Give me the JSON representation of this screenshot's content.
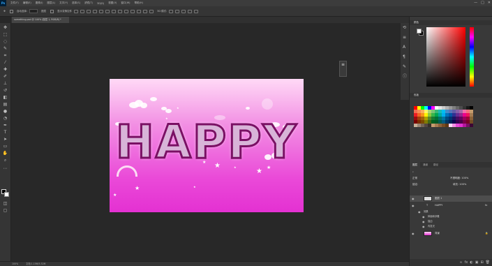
{
  "app": {
    "logo": "Ps"
  },
  "menu": {
    "items": [
      "文件(F)",
      "编辑(E)",
      "图像(I)",
      "图层(L)",
      "文字(Y)",
      "选择(S)",
      "滤镜(T)",
      "3D(D)",
      "视图(V)",
      "窗口(W)",
      "帮助(H)"
    ]
  },
  "window_controls": {
    "minimize": "—",
    "maximize": "□",
    "close": "✕"
  },
  "options_bar": {
    "auto_select_label": "自动选择:",
    "auto_select_value": "图层",
    "transform_label": "显示变换控件"
  },
  "document_tab": {
    "label": "something.psd @ 100% (图层 1, RGB/8) *"
  },
  "canvas": {
    "headline": "HAPPY",
    "colors": {
      "gradient_top": "#ffd9f6",
      "gradient_bottom": "#e431d2",
      "text_stroke": "#7a1064",
      "text_fill": "#d8b4d8"
    }
  },
  "mini_panel": {
    "icon": "≡"
  },
  "status_bar": {
    "zoom": "100%",
    "doc_info": "文档:1.15M/5.32M"
  },
  "color_panel": {
    "title": "颜色"
  },
  "swatches_panel": {
    "title": "色板",
    "colors": [
      "#ff0000",
      "#ffff00",
      "#00ff00",
      "#00ffff",
      "#0000ff",
      "#ff00ff",
      "#ffffff",
      "#e5e5e5",
      "#cccccc",
      "#b3b3b3",
      "#999999",
      "#808080",
      "#666666",
      "#4d4d4d",
      "#333333",
      "#1a1a1a",
      "#000000",
      "#f26c4f",
      "#f68e56",
      "#fbaf5c",
      "#fff467",
      "#acd372",
      "#7cc576",
      "#3bb878",
      "#1abbb4",
      "#00bff3",
      "#438ccb",
      "#5574b9",
      "#605ca8",
      "#855fa8",
      "#a763a8",
      "#f06ea9",
      "#f26d7d",
      "#c69c6d",
      "#ed1c24",
      "#f26522",
      "#f7941d",
      "#fff200",
      "#8dc63f",
      "#39b54a",
      "#00a651",
      "#00a99d",
      "#00aeef",
      "#0072bc",
      "#0054a6",
      "#2e3192",
      "#662d91",
      "#92278f",
      "#ec008c",
      "#ed145b",
      "#a67c52",
      "#9e0b0f",
      "#a0410d",
      "#a3620a",
      "#aba000",
      "#598527",
      "#197b30",
      "#007236",
      "#00746b",
      "#0076a3",
      "#004b80",
      "#003471",
      "#1b1464",
      "#440e62",
      "#630460",
      "#9e005d",
      "#9e0039",
      "#8c6239",
      "#790000",
      "#7b2e00",
      "#7d4900",
      "#827b00",
      "#406618",
      "#005e20",
      "#005826",
      "#005952",
      "#005b7f",
      "#003663",
      "#002157",
      "#0d004c",
      "#32004b",
      "#4b0049",
      "#7b0046",
      "#7a0026",
      "#754c24",
      "#c7b299",
      "#998675",
      "#736357",
      "#534741",
      "#37302a",
      "#c69c6d",
      "#a67c52",
      "#8c6239",
      "#754c24",
      "#603913",
      "#ffd9f6",
      "#f28ee3",
      "#ea49d8",
      "#e431d2",
      "#b5179e",
      "#7a1064",
      "#3c0634"
    ]
  },
  "layers_panel": {
    "tabs": [
      "图层",
      "通道",
      "路径"
    ],
    "blend_mode": "正常",
    "opacity": "不透明度: 100%",
    "fill": "填充: 100%",
    "lock_label": "锁定:",
    "layers": [
      {
        "name": "图层 1",
        "selected": true
      },
      {
        "name": "HAPPY",
        "type_icon": "T",
        "selected": false
      },
      {
        "name": "背景",
        "selected": false
      }
    ],
    "effects_label": "效果",
    "effects": [
      "斜面和浮雕",
      "描边",
      "内发光"
    ],
    "footer_icons": [
      "∞",
      "fx",
      "◐",
      "▣",
      "⊞",
      "🗑"
    ]
  }
}
